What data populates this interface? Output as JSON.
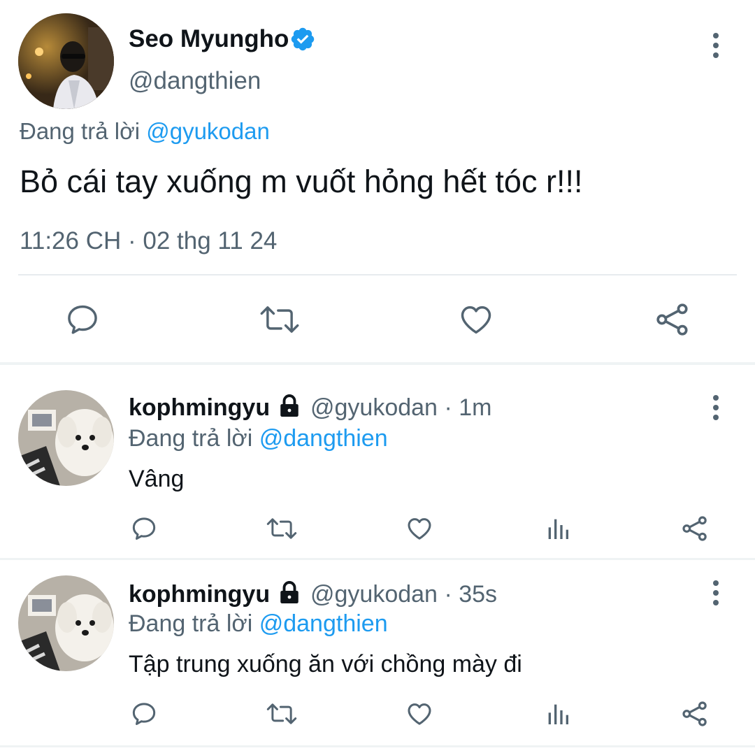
{
  "main_tweet": {
    "display_name": "Seo Myungho",
    "handle": "@dangthien",
    "reply_prefix": "Đang trả lời",
    "reply_to": "@gyukodan",
    "text": "Bỏ cái tay xuống m vuốt hỏng hết tóc r!!!",
    "timestamp": "11:26 CH · 02 thg 11 24",
    "icons": [
      "reply-icon",
      "retweet-icon",
      "like-icon",
      "share-icon"
    ]
  },
  "replies": [
    {
      "display_name": "kophmingyu",
      "handle": "@gyukodan",
      "time": "· 1m",
      "reply_prefix": "Đang trả lời",
      "reply_to": "@dangthien",
      "text": "Vâng"
    },
    {
      "display_name": "kophmingyu",
      "handle": "@gyukodan",
      "time": "· 35s",
      "reply_prefix": "Đang trả lời",
      "reply_to": "@dangthien",
      "text": "Tập trung xuống ăn với chồng mày đi"
    }
  ],
  "colors": {
    "accent": "#1d9bf0",
    "secondary_text": "#536471",
    "primary_text": "#0f1419",
    "verified": "#1d9bf0"
  }
}
